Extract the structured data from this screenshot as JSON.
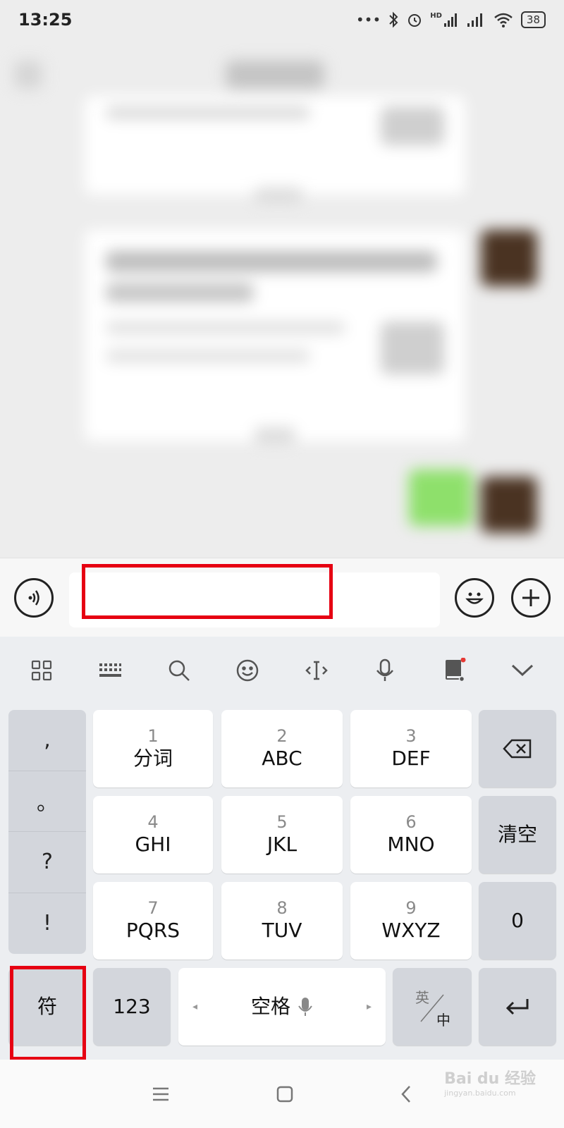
{
  "status_bar": {
    "time": "13:25",
    "signal_label": "HD",
    "battery": "38"
  },
  "keyboard": {
    "punctuation": [
      ",",
      "。",
      "?",
      "!"
    ],
    "keys": [
      {
        "num": "1",
        "letters": "分词"
      },
      {
        "num": "2",
        "letters": "ABC"
      },
      {
        "num": "3",
        "letters": "DEF"
      },
      {
        "num": "4",
        "letters": "GHI"
      },
      {
        "num": "5",
        "letters": "JKL"
      },
      {
        "num": "6",
        "letters": "MNO"
      },
      {
        "num": "7",
        "letters": "PQRS"
      },
      {
        "num": "8",
        "letters": "TUV"
      },
      {
        "num": "9",
        "letters": "WXYZ"
      }
    ],
    "clear_label": "清空",
    "zero_label": "0",
    "symbol_label": "符",
    "numbers_label": "123",
    "space_label": "空格",
    "lang_top": "英",
    "lang_bottom": "中"
  },
  "watermark": {
    "brand": "Bai du 经验",
    "url": "jingyan.baidu.com"
  },
  "colors": {
    "highlight": "#e60012",
    "keyboard_bg": "#eceef1",
    "dark_key": "#d3d6dc",
    "notification_dot": "#e53935"
  },
  "icons": {
    "input_bar": [
      "voice-input-icon",
      "emoji-icon",
      "add-icon"
    ],
    "toolbar": [
      "grid-menu-icon",
      "keyboard-icon",
      "search-icon",
      "emoji-face-icon",
      "cursor-icon",
      "microphone-icon",
      "dictionary-icon",
      "collapse-icon"
    ],
    "nav": [
      "menu-icon",
      "home-icon",
      "back-icon"
    ]
  }
}
